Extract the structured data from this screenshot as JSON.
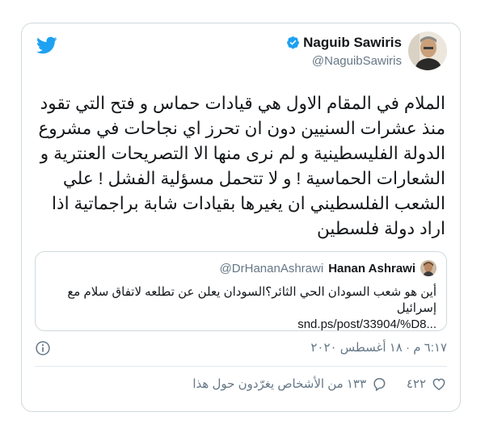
{
  "colors": {
    "twitter_blue": "#1da1f2",
    "text_primary": "#14171a",
    "text_secondary": "#657786",
    "border": "#cfd9de"
  },
  "icons": {
    "brand": "twitter-bird-icon",
    "verified": "verified-badge-icon",
    "info": "info-icon",
    "like": "heart-icon",
    "reply": "reply-bubble-icon"
  },
  "tweet": {
    "author_name": "Naguib Sawiris",
    "author_handle": "@NaguibSawiris",
    "text": "الملام في المقام الاول هي قيادات حماس و فتح التي تقود منذ عشرات السنيين دون ان تحرز اي نجاحات في مشروع الدولة الفليسطينية و لم نرى منها الا التصريحات العنترية و الشعارات الحماسية ! و لا تتحمل مسؤلية الفشل ! علي الشعب الفلسطيني ان يغيرها بقيادات شابة براجماتية اذا اراد دولة فلسطين",
    "timestamp": "٦:١٧ م · ١٨ أغسطس ٢٠٢٠",
    "likes_count": "٤٢٢",
    "replies_text": "١٣٣ من الأشخاص يغرّدون حول هذا"
  },
  "quoted_tweet": {
    "author_name": "Hanan Ashrawi",
    "author_handle": "@DrHananAshrawi",
    "text": "أين هو شعب السودان الحي الثائر؟السودان يعلن عن تطلعه لاتفاق سلام  مع إسرائيل",
    "link": "snd.ps/post/33904/%D8..."
  }
}
